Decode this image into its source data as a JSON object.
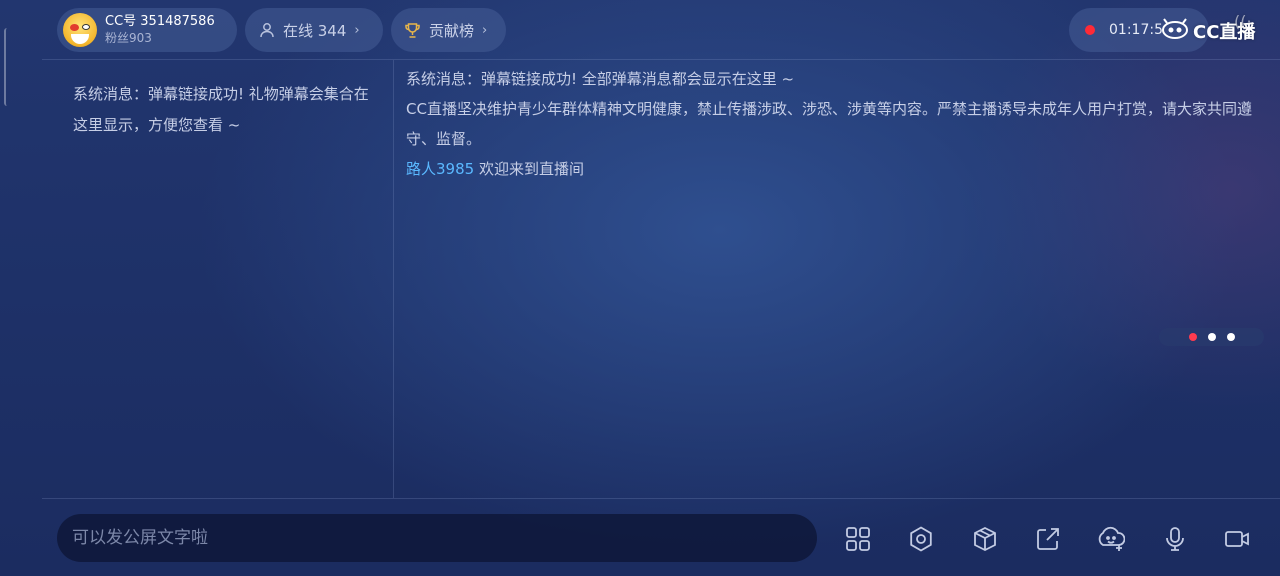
{
  "anchor": {
    "cc_id": "CC号 351487586",
    "fans": "粉丝903"
  },
  "online": {
    "label": "在线 344"
  },
  "contribution": {
    "label": "贡献榜"
  },
  "live": {
    "timer": "01:17:5",
    "logo_text": "CC直播",
    "status_color": "#ff2a36"
  },
  "left_panel": {
    "system_message": "系统消息：弹幕链接成功! 礼物弹幕会集合在这里显示，方便您查看 ~"
  },
  "chat": {
    "messages": [
      {
        "text": "系统消息：弹幕链接成功! 全部弹幕消息都会显示在这里 ~"
      },
      {
        "text": "CC直播坚决维护青少年群体精神文明健康，禁止传播涉政、涉恐、涉黄等内容。严禁主播诱导未成年人用户打赏，请大家共同遵守、监督。"
      },
      {
        "user": "路人3985",
        "text": " 欢迎来到直播间"
      }
    ],
    "username_color": "#5ab8ff"
  },
  "pager": {
    "count": 3,
    "active_index": 0,
    "active_color": "#ff3b4f"
  },
  "input": {
    "placeholder": "可以发公屏文字啦"
  },
  "toolbar": {
    "icons": [
      "apps-grid-icon",
      "settings-gear-icon",
      "gift-box-icon",
      "share-icon",
      "emoji-icon",
      "microphone-icon",
      "camera-icon"
    ]
  }
}
